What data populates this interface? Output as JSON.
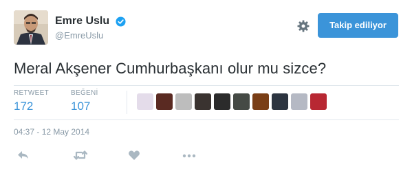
{
  "user": {
    "display_name": "Emre Uslu",
    "handle": "@EmreUslu",
    "avatar_icon": "user-avatar"
  },
  "header": {
    "follow_label": "Takip ediliyor",
    "settings_icon": "gear-icon",
    "accent_color": "#3b94d9"
  },
  "tweet": {
    "text": "Meral Akşener Cumhurbaşkanı olur mu sizce?",
    "timestamp": "04:37 - 12 May 2014"
  },
  "stats": {
    "retweet_label": "RETWEET",
    "retweet_count": "172",
    "like_label": "BEĞENİ",
    "like_count": "107"
  },
  "likers": [
    {
      "name": "liker-avatar",
      "color": "#e4dcea"
    },
    {
      "name": "liker-avatar",
      "color": "#5a2a22"
    },
    {
      "name": "liker-avatar",
      "color": "#bdbdbd"
    },
    {
      "name": "liker-avatar",
      "color": "#3a3330"
    },
    {
      "name": "liker-avatar",
      "color": "#2b2b2b"
    },
    {
      "name": "liker-avatar",
      "color": "#454a45"
    },
    {
      "name": "liker-avatar",
      "color": "#7a3e16"
    },
    {
      "name": "liker-avatar",
      "color": "#2c3440"
    },
    {
      "name": "liker-avatar",
      "color": "#b5b9c4"
    },
    {
      "name": "liker-avatar",
      "color": "#b82833"
    }
  ],
  "actions": [
    {
      "name": "reply-icon"
    },
    {
      "name": "retweet-icon"
    },
    {
      "name": "like-icon"
    },
    {
      "name": "more-icon"
    }
  ]
}
